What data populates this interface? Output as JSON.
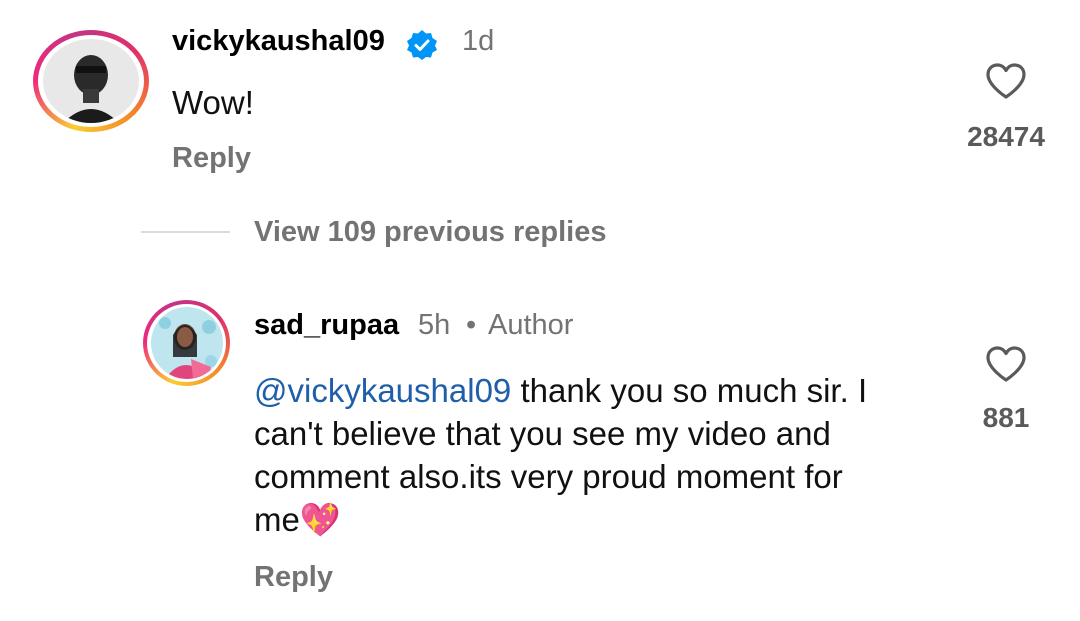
{
  "comment": {
    "username": "vickykaushal09",
    "verified": true,
    "time": "1d",
    "text": "Wow!",
    "reply_label": "Reply",
    "likes": "28474"
  },
  "view_replies": "View 109 previous replies",
  "reply": {
    "username": "sad_rupaa",
    "time": "5h",
    "separator": "•",
    "badge": "Author",
    "mention": "@vickykaushal09",
    "text_lines": [
      " thank you so much sir. I",
      "can't believe that you see my video and",
      "comment also.its very proud moment for",
      "me"
    ],
    "emoji": "💖",
    "reply_label": "Reply",
    "likes": "881"
  },
  "colors": {
    "verified": "#0095f6",
    "mention": "#1f5ea8",
    "secondary_text": "#737373"
  },
  "icons": [
    "verified-badge-icon",
    "heart-outline-icon"
  ]
}
